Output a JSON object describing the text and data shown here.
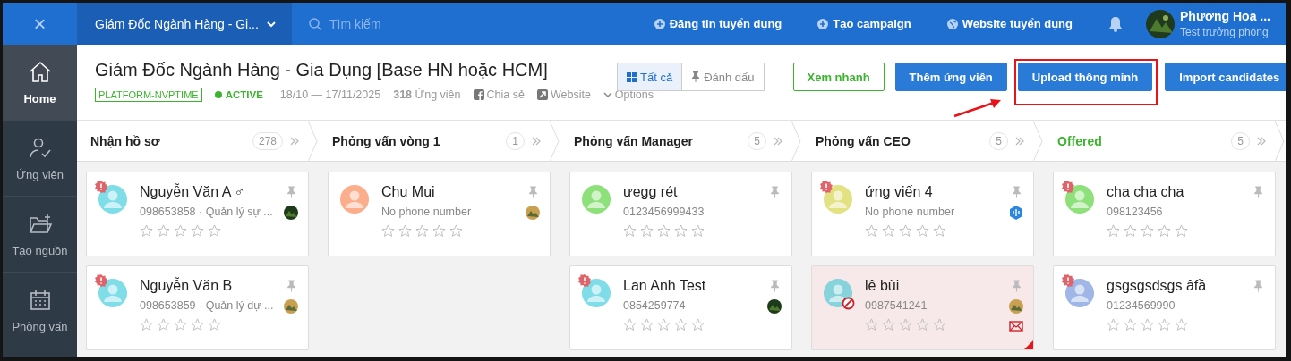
{
  "topbar": {
    "close": "×",
    "job_selector": "Giám Đốc Ngành Hàng - Gi...",
    "search": {
      "placeholder": "Tìm kiếm"
    },
    "actions": [
      "Đăng tin tuyển dụng",
      "Tạo campaign",
      "Website tuyển dụng"
    ],
    "user": {
      "name": "Phương Hoa ...",
      "role": "Test trưởng phòng"
    }
  },
  "sidebar": {
    "items": [
      {
        "label": "Home",
        "selected": true
      },
      {
        "label": "Ứng viên",
        "selected": false
      },
      {
        "label": "Tạo nguồn",
        "selected": false
      },
      {
        "label": "Phỏng vấn",
        "selected": false
      }
    ]
  },
  "job": {
    "title": "Giám Đốc Ngành Hàng - Gia Dụng [Base HN hoặc HCM]",
    "tag": "PLATFORM-NVPTIME",
    "status": "ACTIVE",
    "dates": "18/10 — 17/11/2025",
    "candidates": "**318** Ứng viên",
    "share": "Chia sẻ",
    "website": "Website",
    "options": "Options",
    "filters": [
      {
        "label": "Tất cả",
        "selected": true
      },
      {
        "label": "Đánh dấu",
        "selected": false
      }
    ],
    "buttons": [
      {
        "label": "Xem nhanh",
        "kind": "outline",
        "highlighted": false
      },
      {
        "label": "Thêm ứng viên",
        "kind": "primary",
        "highlighted": false
      },
      {
        "label": "Upload thông minh",
        "kind": "primary",
        "highlighted": true
      },
      {
        "label": "Import candidates",
        "kind": "primary",
        "highlighted": false
      }
    ]
  },
  "columns": [
    {
      "name": "Nhận hồ sơ",
      "count": "278",
      "color": "#222222",
      "cards": [
        {
          "name": "Nguyễn Văn A ♂",
          "info": "098653858 · Quản lý sự ...",
          "color": "#7fdde8",
          "alert": true,
          "rejected": false,
          "mail": false,
          "flagged": false,
          "stars": 0
        },
        {
          "name": "Nguyễn Văn B",
          "info": "098653859 · Quản lý dự ...",
          "color": "#7fdde8",
          "alert": true,
          "rejected": false,
          "mail": false,
          "flagged": false,
          "stars": 0
        }
      ]
    },
    {
      "name": "Phỏng vấn vòng 1",
      "count": "1",
      "color": "#222222",
      "cards": [
        {
          "name": "Chu Mui",
          "info": "No phone number",
          "color": "#fcae8c",
          "alert": false,
          "rejected": false,
          "mail": false,
          "flagged": false,
          "stars": 0
        }
      ]
    },
    {
      "name": "Phỏng vấn Manager",
      "count": "5",
      "color": "#222222",
      "cards": [
        {
          "name": "ưegg rét",
          "info": "0123456999433",
          "color": "#8ee07a",
          "alert": false,
          "rejected": false,
          "mail": false,
          "flagged": false,
          "stars": 0
        },
        {
          "name": "Lan Anh Test",
          "info": "0854259774",
          "color": "#7fdde8",
          "alert": true,
          "rejected": false,
          "mail": false,
          "flagged": false,
          "stars": 0
        }
      ]
    },
    {
      "name": "Phỏng vấn CEO",
      "count": "5",
      "color": "#222222",
      "cards": [
        {
          "name": "ứng viến 4",
          "info": "No phone number",
          "color": "#e3e283",
          "alert": true,
          "rejected": false,
          "owner": {
            "kind": "app"
          },
          "mail": false,
          "flagged": false,
          "stars": 0
        },
        {
          "name": "lê bùi",
          "info": "0987541241",
          "color": "#86d3db",
          "alert": false,
          "rejected": true,
          "mail": true,
          "flagged": true,
          "stars": 0
        }
      ]
    },
    {
      "name": "Offered",
      "count": "5",
      "color": "#3cb32e",
      "cards": [
        {
          "name": "cha cha cha",
          "info": "098123456",
          "color": "#8ee07a",
          "alert": true,
          "rejected": false,
          "mail": false,
          "flagged": false,
          "stars": 0
        },
        {
          "name": "gsgsgsdsgs âfầ",
          "info": "01234569990",
          "color": "#9fb6e6",
          "alert": true,
          "rejected": false,
          "mail": false,
          "flagged": false,
          "stars": 0
        }
      ]
    }
  ]
}
